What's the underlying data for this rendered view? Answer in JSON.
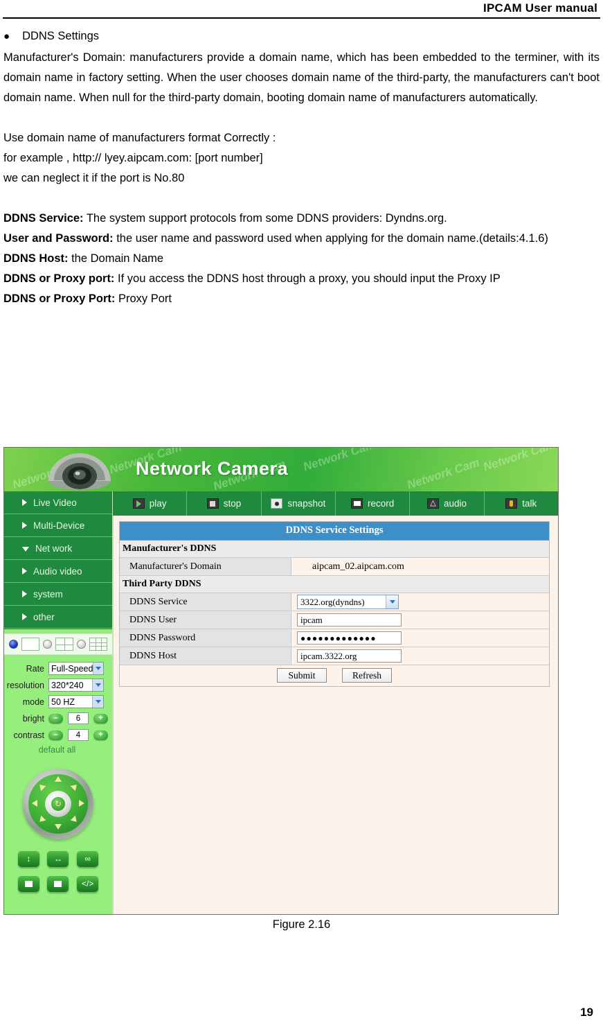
{
  "document": {
    "header_title": "IPCAM User manual",
    "page_number": "19",
    "figure_caption": "Figure 2.16",
    "bullet_heading": "DDNS Settings",
    "bullet_glyph": "●",
    "paragraph1": "Manufacturer's Domain: manufacturers provide a domain  name, which  has been embedded to the terminer, with its domain  name in factory setting. When the user chooses domain name of  the third-party, the manufacturers can't boot domain name. When null for the third-party  domain, booting domain name of manufacturers automatically.",
    "line_use": "Use   domain name of manufacturers format Correctly :",
    "line_example": "for example , http:// lyey.aipcam.com: [port number]",
    "line_neglect": "we can neglect it if the port is No.80",
    "defs": [
      {
        "term": "DDNS Service:",
        "desc": " The system support protocols from some DDNS providers: Dyndns.org."
      },
      {
        "term": "User and Password:",
        "desc": " the user name and password used when applying for the domain name.(details:4.1.6)"
      },
      {
        "term": "DDNS Host:",
        "desc": " the Domain Name"
      },
      {
        "term": "DDNS or Proxy port:",
        "desc": " If you access the DDNS host through a proxy, you should input the Proxy IP"
      },
      {
        "term": "DDNS or Proxy Port:",
        "desc": " Proxy Port"
      }
    ]
  },
  "camera_ui": {
    "banner": {
      "title": "Network Camera",
      "watermark": "Network Cam",
      "gradient_start": "#7fd24e",
      "gradient_end": "#8ad857"
    },
    "toolbar": [
      {
        "label": "play",
        "icon": "play-icon"
      },
      {
        "label": "stop",
        "icon": "stop-icon"
      },
      {
        "label": "snapshot",
        "icon": "snapshot-icon"
      },
      {
        "label": "record",
        "icon": "record-icon"
      },
      {
        "label": "audio",
        "icon": "audio-icon"
      },
      {
        "label": "talk",
        "icon": "talk-icon"
      }
    ],
    "sidebar": {
      "accent": "#1f8a3f",
      "items": [
        {
          "label": "Live Video",
          "expanded": false
        },
        {
          "label": "Multi-Device",
          "expanded": false
        },
        {
          "label": "Net work",
          "expanded": true
        },
        {
          "label": "Audio video",
          "expanded": false
        },
        {
          "label": "system",
          "expanded": false
        },
        {
          "label": "other",
          "expanded": false
        }
      ],
      "view_modes": [
        "single",
        "four",
        "nine"
      ],
      "controls": [
        {
          "label": "Rate",
          "type": "select",
          "value": "Full-Speed"
        },
        {
          "label": "resolution",
          "type": "select",
          "value": "320*240"
        },
        {
          "label": "mode",
          "type": "select",
          "value": "50 HZ"
        },
        {
          "label": "bright",
          "type": "stepper",
          "value": "6"
        },
        {
          "label": "contrast",
          "type": "stepper",
          "value": "4"
        }
      ],
      "minus_label": "–",
      "plus_label": "+",
      "default_all": "default all",
      "ptz_buttons": [
        "vertical-patrol",
        "horizontal-patrol",
        "infinity-loop",
        "io-on",
        "io-off",
        "code-toggle"
      ]
    },
    "settings": {
      "panel_title": "DDNS Service Settings",
      "panel_title_bg": "#3d8fc7",
      "group1_title": "Manufacturer's DDNS",
      "group2_title": "Third Party DDNS",
      "rows_group1": [
        {
          "label": "Manufacturer's Domain",
          "value": "aipcam_02.aipcam.com",
          "type": "readonly"
        }
      ],
      "rows_group2": [
        {
          "label": "DDNS Service",
          "value": "3322.org(dyndns)",
          "type": "select"
        },
        {
          "label": "DDNS User",
          "value": "ipcam",
          "type": "text"
        },
        {
          "label": "DDNS Password",
          "value": "●●●●●●●●●●●●●",
          "type": "password"
        },
        {
          "label": "DDNS Host",
          "value": "ipcam.3322.org",
          "type": "text"
        }
      ],
      "submit_label": "Submit",
      "refresh_label": "Refresh"
    }
  }
}
